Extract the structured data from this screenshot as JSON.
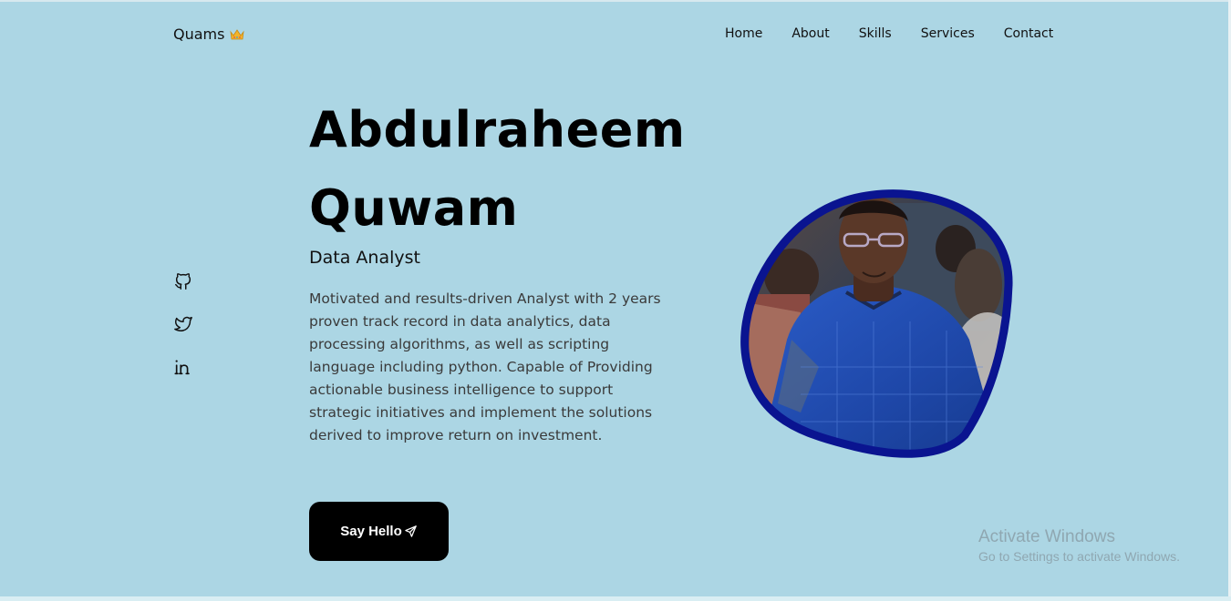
{
  "header": {
    "logo_text": "Quams",
    "logo_icon": "crown-icon",
    "nav": [
      "Home",
      "About",
      "Skills",
      "Services",
      "Contact"
    ]
  },
  "socials": [
    {
      "icon": "github-icon"
    },
    {
      "icon": "twitter-icon"
    },
    {
      "icon": "linkedin-icon"
    }
  ],
  "hero": {
    "name_line1": "Abdulraheem",
    "name_line2": "Quwam",
    "role": "Data Analyst",
    "description": "Motivated and results-driven Analyst with 2 years proven track record in data analytics, data processing algorithms, as well as scripting language including python. Capable of Providing actionable business intelligence to support strategic initiatives and implement the solutions derived to improve return on investment.",
    "cta_label": "Say Hello",
    "cta_icon": "send-icon"
  },
  "watermark": {
    "title": "Activate Windows",
    "subtitle": "Go to Settings to activate Windows."
  },
  "colors": {
    "background": "#acd6e4",
    "blob_border": "#0a1490",
    "button": "#000000"
  }
}
